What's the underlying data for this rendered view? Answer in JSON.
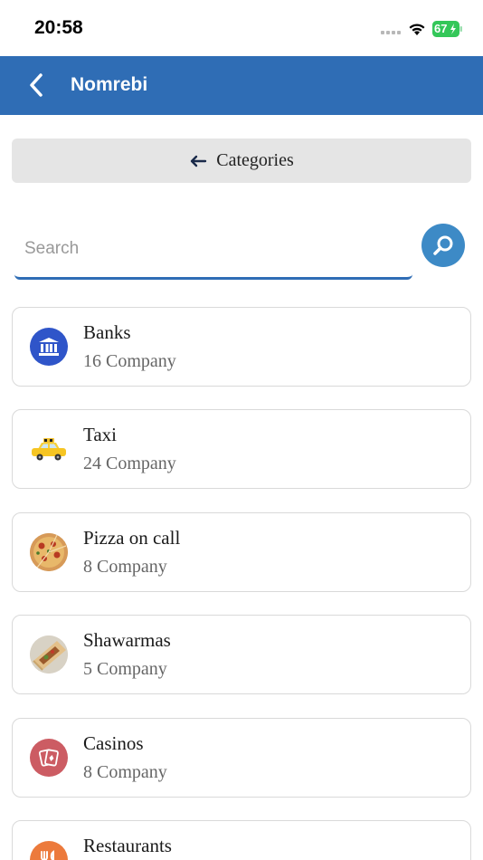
{
  "status_bar": {
    "time": "20:58",
    "battery": "67"
  },
  "header": {
    "title": "Nomrebi"
  },
  "categories_button": {
    "label": "Categories"
  },
  "search": {
    "placeholder": "Search",
    "value": ""
  },
  "categories": [
    {
      "name": "Banks",
      "count": "16 Company",
      "icon": "bank-icon"
    },
    {
      "name": "Taxi",
      "count": "24 Company",
      "icon": "taxi-icon"
    },
    {
      "name": "Pizza on call",
      "count": "8 Company",
      "icon": "pizza-icon"
    },
    {
      "name": "Shawarmas",
      "count": "5 Company",
      "icon": "shawarma-icon"
    },
    {
      "name": "Casinos",
      "count": "8 Company",
      "icon": "casino-icon"
    },
    {
      "name": "Restaurants",
      "count": "",
      "icon": "restaurant-icon"
    }
  ],
  "colors": {
    "header": "#2f6db5",
    "search_button": "#3d8ac6",
    "battery": "#34c759"
  }
}
